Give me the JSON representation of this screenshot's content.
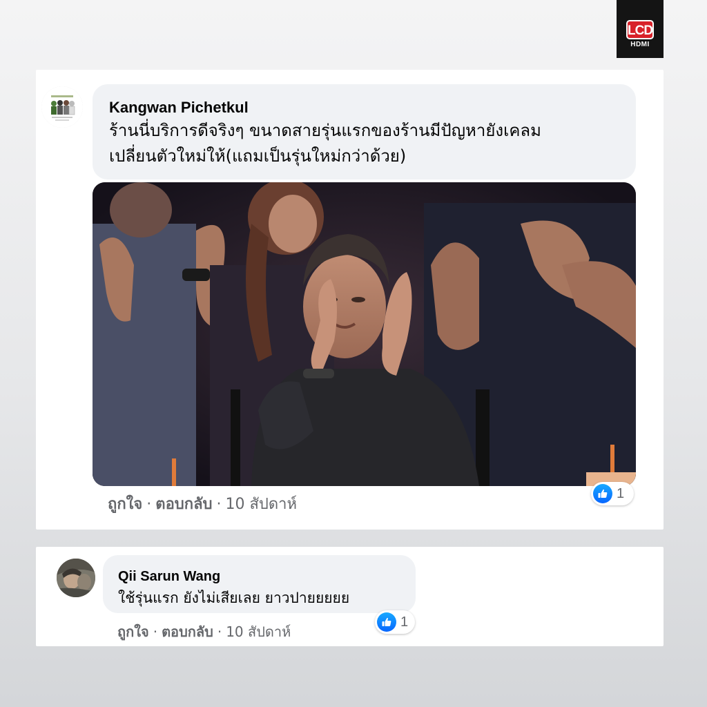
{
  "logo": {
    "badge": "LCD",
    "sub": "HDMI"
  },
  "comments": [
    {
      "author": "Kangwan Pichetkul",
      "text_line1": "ร้านนี่บริการดีจริงๆ ขนาดสายรุ่นแรกของร้านมีปัญหายังเคลม",
      "text_line2": "เปลี่ยนตัวใหม่ให้(แถมเป็นรุ่นใหม่กว่าด้วย)",
      "like_label": "ถูกใจ",
      "reply_label": "ตอบกลับ",
      "time": "10 สัปดาห์",
      "reaction_count": "1"
    },
    {
      "author": "Qii Sarun Wang",
      "text": "ใช้รุ่นแรก ยังไม่เสียเลย ยาวปายยยยย",
      "like_label": "ถูกใจ",
      "reply_label": "ตอบกลับ",
      "time": "10 สัปดาห์",
      "reaction_count": "1"
    }
  ],
  "separator": "·",
  "colors": {
    "like_blue": "#0866ff",
    "bubble_bg": "#f0f2f5",
    "meta_gray": "#65676b"
  },
  "icons": {
    "reaction": "thumbs-up-icon"
  }
}
